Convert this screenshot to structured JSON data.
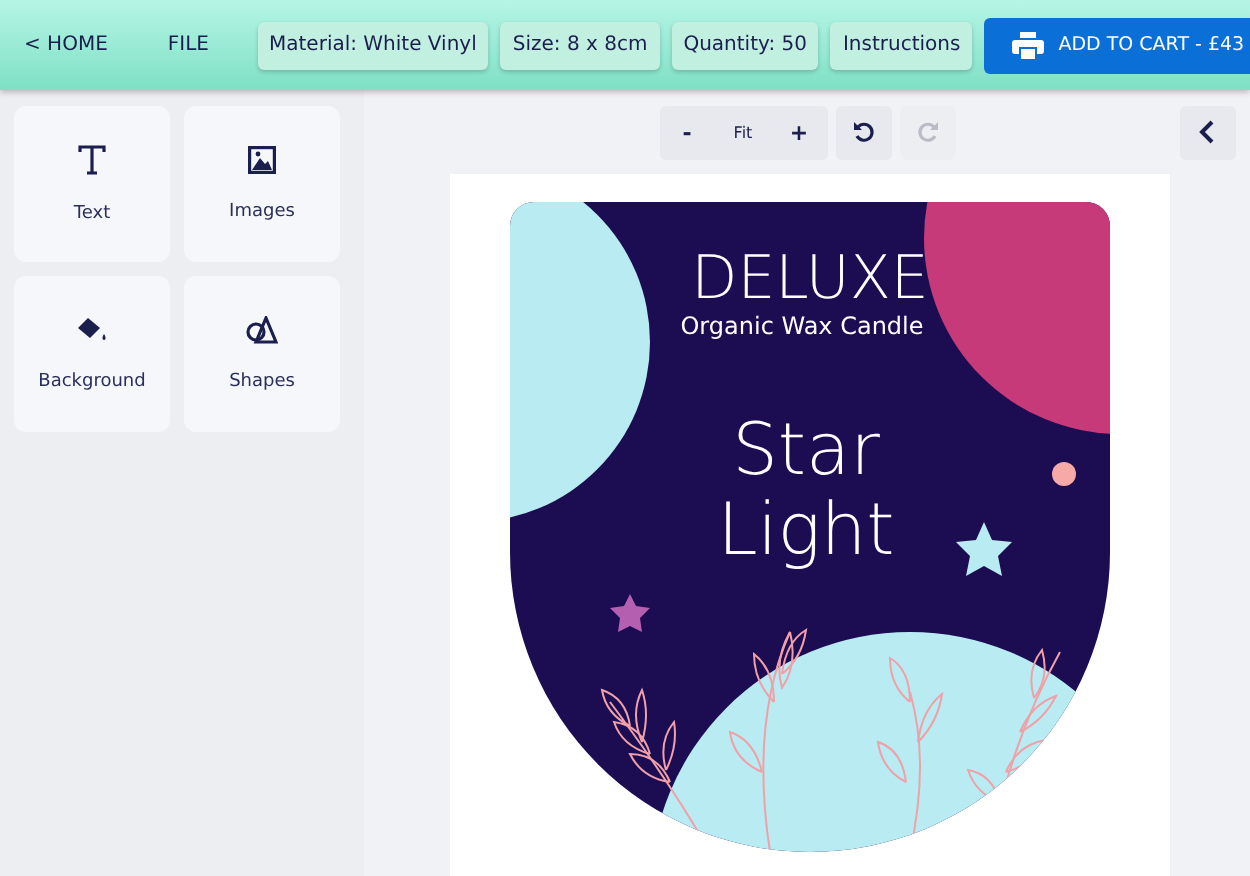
{
  "topbar": {
    "home": "< HOME",
    "file": "FILE",
    "options": [
      "Material: White Vinyl",
      "Size: 8 x 8cm",
      "Quantity: 50",
      "Instructions"
    ],
    "cart": "ADD TO CART - £43"
  },
  "sidebar": {
    "items": [
      {
        "kind": "text",
        "label": "Text"
      },
      {
        "kind": "images",
        "label": "Images"
      },
      {
        "kind": "background",
        "label": "Background"
      },
      {
        "kind": "shapes",
        "label": "Shapes"
      }
    ]
  },
  "zoom": {
    "minus": "-",
    "fit": "Fit",
    "plus": "+"
  },
  "history": [
    {
      "kind": "undo",
      "disabled": false
    },
    {
      "kind": "redo",
      "disabled": true
    }
  ],
  "label": {
    "title": "DELUXE",
    "subtitle": "Organic Wax Candle",
    "name_lines": [
      "Star",
      "Light"
    ]
  }
}
